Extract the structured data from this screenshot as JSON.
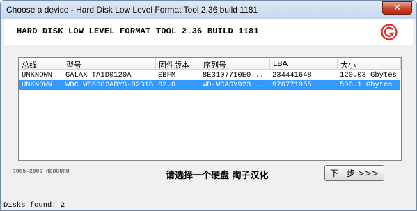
{
  "window": {
    "title": "Choose a device - Hard Disk Low Level Format Tool 2.36 build 1181",
    "close_label": "✕"
  },
  "banner": {
    "title": "HARD DISK LOW LEVEL FORMAT TOOL 2.36 BUILD 1181",
    "logo_icon": "hddguru-logo-icon",
    "accent_color": "#e0332e"
  },
  "device_list": {
    "columns": [
      "总线",
      "型号",
      "固件版本",
      "序列号",
      "LBA",
      "大小"
    ],
    "rows": [
      {
        "bus": "UNKNOWN",
        "model": "GALAX TA1D0120A",
        "firmware": "SBFM",
        "serial": "8E3107710E0...",
        "lba": "234441648",
        "size": "120.03 Gbytes",
        "selected": false
      },
      {
        "bus": "UNKNOWN",
        "model": "WDC WD5002ABYS-02B1B",
        "firmware": "02.0",
        "serial": "WD-WCASY923...",
        "lba": "976771055",
        "size": "500.1 Gbytes",
        "selected": true
      }
    ],
    "selection_color": "#3399ff"
  },
  "footer": {
    "copyright": "?005-2006 HDDGURU",
    "credit": "请选择一个硬盘   陶子汉化",
    "next_button": "下一步 >>>"
  },
  "status": {
    "text": "Disks found: 2"
  }
}
